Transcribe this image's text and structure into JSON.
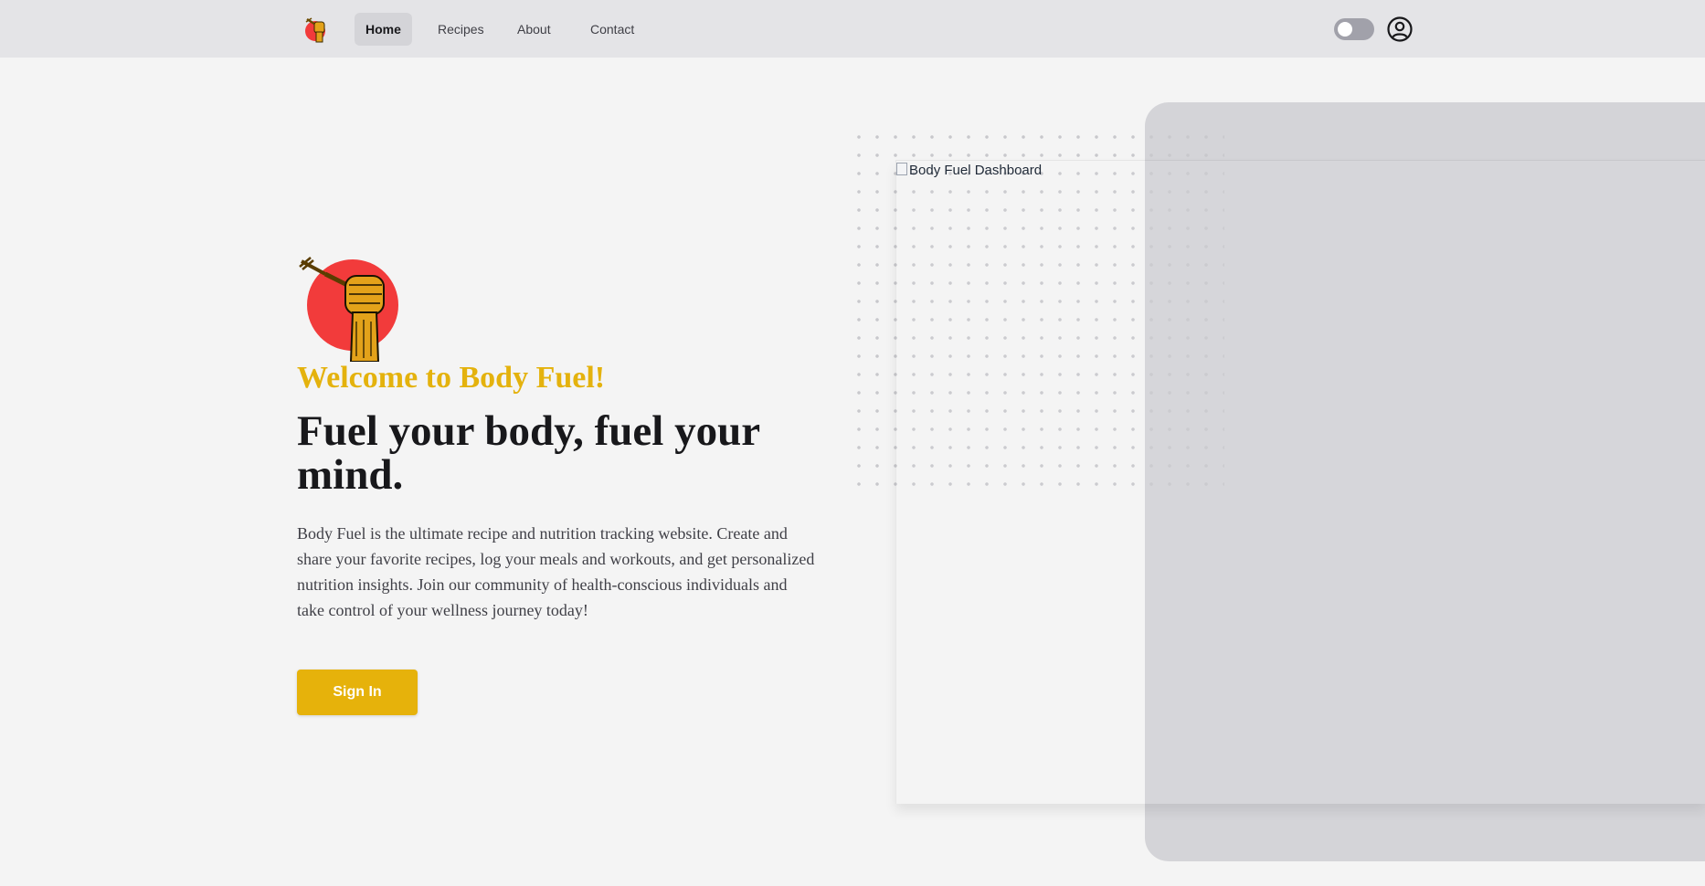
{
  "nav": {
    "logo_icon": "fist-fork-icon",
    "links": [
      {
        "label": "Home",
        "active": true
      },
      {
        "label": "Recipes",
        "active": false
      },
      {
        "label": "About",
        "active": false
      },
      {
        "label": "Contact",
        "active": false
      }
    ],
    "theme_toggle_on": false,
    "user_icon": "user-circle-icon"
  },
  "hero": {
    "welcome": "Welcome to Body Fuel!",
    "headline": "Fuel your body, fuel your mind.",
    "description": "Body Fuel is the ultimate recipe and nutrition tracking website. Create and share your favorite recipes, log your meals and workouts, and get personalized nutrition insights. Join our community of health-conscious individuals and take control of your wellness journey today!",
    "signin_label": "Sign In",
    "dashboard_image_alt": "Body Fuel Dashboard"
  },
  "colors": {
    "accent": "#e6b20b",
    "welcome_text": "#e4b20d",
    "logo_red": "#f23b3b",
    "navbar_bg": "#e4e4e7",
    "page_bg": "#f4f4f4",
    "panel_bg": "#d4d4d8"
  }
}
